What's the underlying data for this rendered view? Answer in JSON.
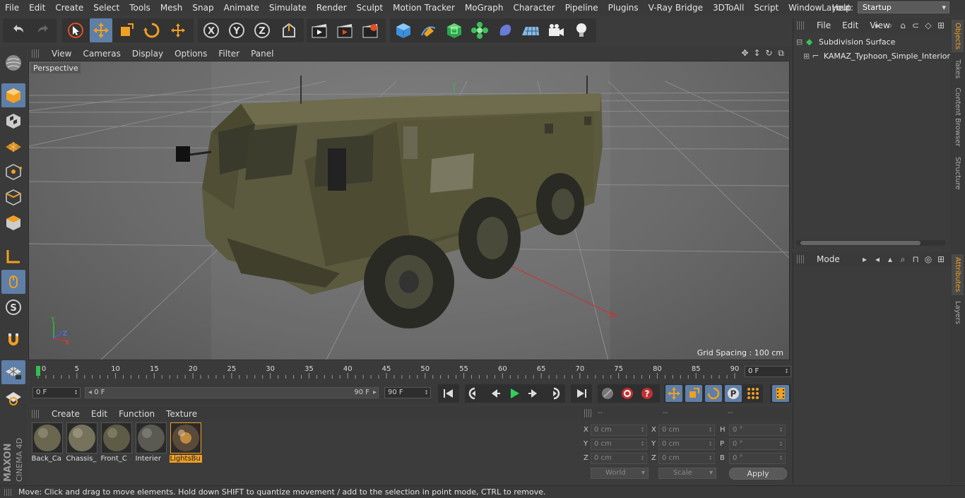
{
  "menu": [
    "File",
    "Edit",
    "Create",
    "Select",
    "Tools",
    "Mesh",
    "Snap",
    "Animate",
    "Simulate",
    "Render",
    "Sculpt",
    "Motion Tracker",
    "MoGraph",
    "Character",
    "Pipeline",
    "Plugins",
    "V-Ray Bridge",
    "3DToAll",
    "Script",
    "Window",
    "Help"
  ],
  "layout": {
    "label": "Layout:",
    "value": "Startup"
  },
  "viewport": {
    "menu": [
      "View",
      "Cameras",
      "Display",
      "Options",
      "Filter",
      "Panel"
    ],
    "label": "Perspective",
    "grid_spacing": "Grid Spacing : 100 cm",
    "axis_labels": {
      "y": "Y",
      "z": "Z",
      "x": "X"
    }
  },
  "timeline": {
    "ticks": [
      "0",
      "5",
      "10",
      "15",
      "20",
      "25",
      "30",
      "35",
      "40",
      "45",
      "50",
      "55",
      "60",
      "65",
      "70",
      "75",
      "80",
      "85",
      "90"
    ],
    "current_frame": "0 F",
    "start_field": "0 F",
    "range_start": "0 F",
    "range_end": "90 F",
    "end_field": "90 F"
  },
  "materials": {
    "menu": [
      "Create",
      "Edit",
      "Function",
      "Texture"
    ],
    "items": [
      {
        "name": "Back_Ca"
      },
      {
        "name": "Chassis_"
      },
      {
        "name": "Front_C"
      },
      {
        "name": "Interier"
      },
      {
        "name": "LightsBu"
      }
    ]
  },
  "coordinates": {
    "headers": [
      "--",
      "--",
      "--"
    ],
    "rows": [
      {
        "l1": "X",
        "v1": "0 cm",
        "l2": "X",
        "v2": "0 cm",
        "l3": "H",
        "v3": "0 °"
      },
      {
        "l1": "Y",
        "v1": "0 cm",
        "l2": "Y",
        "v2": "0 cm",
        "l3": "P",
        "v3": "0 °"
      },
      {
        "l1": "Z",
        "v1": "0 cm",
        "l2": "Z",
        "v2": "0 cm",
        "l3": "B",
        "v3": "0 °"
      }
    ],
    "world": "World",
    "scale": "Scale",
    "apply": "Apply"
  },
  "status": "Move: Click and drag to move elements. Hold down SHIFT to quantize movement / add to the selection in point mode, CTRL to remove.",
  "objects": {
    "menu": [
      "File",
      "Edit",
      "View"
    ],
    "tree": [
      {
        "name": "Subdivision Surface"
      },
      {
        "name": "KAMAZ_Typhoon_Simple_Interior"
      }
    ]
  },
  "attributes": {
    "menu": [
      "Mode"
    ]
  },
  "right_tabs": [
    "Objects",
    "Takes",
    "Content Browser",
    "Structure",
    "Attributes",
    "Layers"
  ],
  "logo": {
    "line1": "MAXON",
    "line2": "CINEMA 4D"
  }
}
